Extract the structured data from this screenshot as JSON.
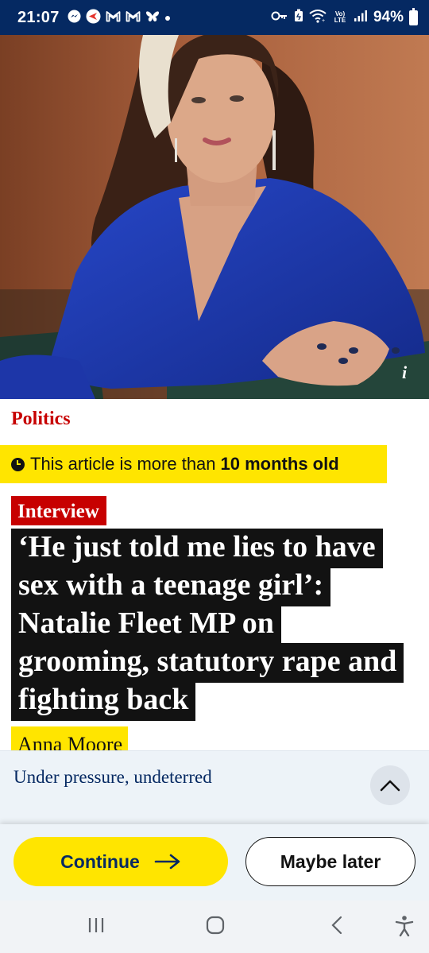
{
  "status_bar": {
    "time": "21:07",
    "battery": "94%",
    "left_icons": [
      "messenger-icon",
      "app-icon",
      "gmail-icon",
      "gmail-icon",
      "butterfly-icon",
      "dot-icon"
    ],
    "right_icons": [
      "key-icon",
      "lock-icon",
      "wifi-icon",
      "volte-icon",
      "signal-icon",
      "battery-icon"
    ],
    "network_label": "Vo) LTE"
  },
  "hero": {
    "info_label": "i"
  },
  "article": {
    "section": "Politics",
    "age_warning_prefix": "This article is more than",
    "age_warning_bold": "10 months old",
    "kicker": "Interview",
    "headline": "‘He just told me lies to have sex with a teenage girl’: Natalie Fleet MP on grooming, statutory rape and fighting back",
    "byline": "Anna Moore"
  },
  "support_sheet": {
    "title": "Under pressure, undeterred",
    "continue_label": "Continue",
    "later_label": "Maybe later"
  },
  "colors": {
    "guardian_blue": "#052962",
    "politics_red": "#c70000",
    "highlight_yellow": "#ffe500",
    "headline_bg": "#121212"
  }
}
